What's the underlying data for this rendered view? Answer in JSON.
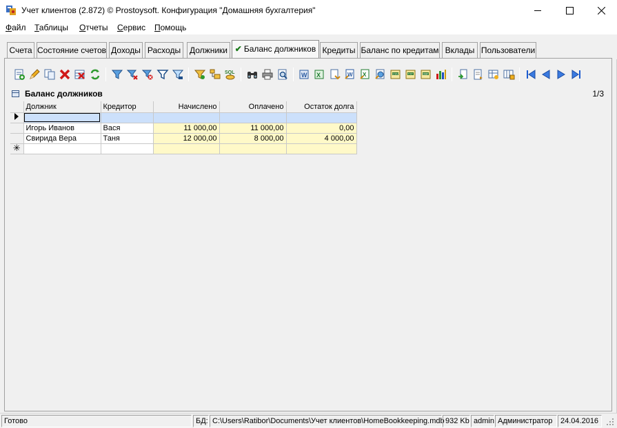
{
  "window": {
    "title": "Учет клиентов (2.872) © Prostoysoft. Конфигурация \"Домашняя бухгалтерия\""
  },
  "menu": [
    {
      "label": "Файл",
      "key": "Ф",
      "rest": "айл"
    },
    {
      "label": "Таблицы",
      "key": "Т",
      "rest": "аблицы"
    },
    {
      "label": "Отчеты",
      "key": "О",
      "rest": "тчеты"
    },
    {
      "label": "Сервис",
      "key": "С",
      "rest": "ервис"
    },
    {
      "label": "Помощь",
      "key": "П",
      "rest": "омощь"
    }
  ],
  "tabs": [
    {
      "label": "Счета",
      "active": false
    },
    {
      "label": "Состояние счетов",
      "active": false
    },
    {
      "label": "Доходы",
      "active": false
    },
    {
      "label": "Расходы",
      "active": false
    },
    {
      "label": "Должники",
      "active": false
    },
    {
      "label": "Баланс должников",
      "active": true
    },
    {
      "label": "Кредиты",
      "active": false
    },
    {
      "label": "Баланс по кредитам",
      "active": false
    },
    {
      "label": "Вклады",
      "active": false
    },
    {
      "label": "Пользователи",
      "active": false
    }
  ],
  "toolbar_icons": [
    "add-record-icon",
    "edit-icon",
    "copy-record-icon",
    "delete-icon",
    "delete-all-icon",
    "refresh-icon",
    "filter-icon",
    "filter-remove-icon",
    "filter-clear-icon",
    "filter-advanced-icon",
    "filter-saved-icon",
    "filter-group-icon",
    "group-icon",
    "sql-icon",
    "find-icon",
    "print-icon",
    "print-preview-icon",
    "export-word-icon",
    "export-excel-icon",
    "export-text-icon",
    "export-word2-icon",
    "export-excel2-icon",
    "export-html-icon",
    "export-csv-icon",
    "export-xml-icon",
    "export-dbf-icon",
    "chart-icon",
    "import-icon",
    "document-icon",
    "table-settings-icon",
    "columns-icon",
    "first-record-icon",
    "prev-record-icon",
    "next-record-icon",
    "last-record-icon"
  ],
  "section": {
    "title": "Баланс должников",
    "count": "1/3"
  },
  "grid": {
    "columns": [
      "Должник",
      "Кредитор",
      "Начислено",
      "Оплачено",
      "Остаток долга"
    ],
    "rows": [
      [
        "",
        "",
        "",
        "",
        ""
      ],
      [
        "Игорь Иванов",
        "Вася",
        "11 000,00",
        "11 000,00",
        "0,00"
      ],
      [
        "Свирида Вера",
        "Таня",
        "12 000,00",
        "8 000,00",
        "4 000,00"
      ]
    ]
  },
  "status": {
    "ready": "Готово",
    "db_label": "БД:",
    "db_path": "C:\\Users\\Ratibor\\Documents\\Учет клиентов\\HomeBookkeeping.mdb",
    "size": "932 Kb",
    "user": "admin",
    "role": "Администратор",
    "date": "24.04.2016"
  },
  "colors": {
    "numeric_cell": "#fff9c8",
    "current_row": "#cce0fb",
    "active_tab_check": "#1a7a1a"
  }
}
